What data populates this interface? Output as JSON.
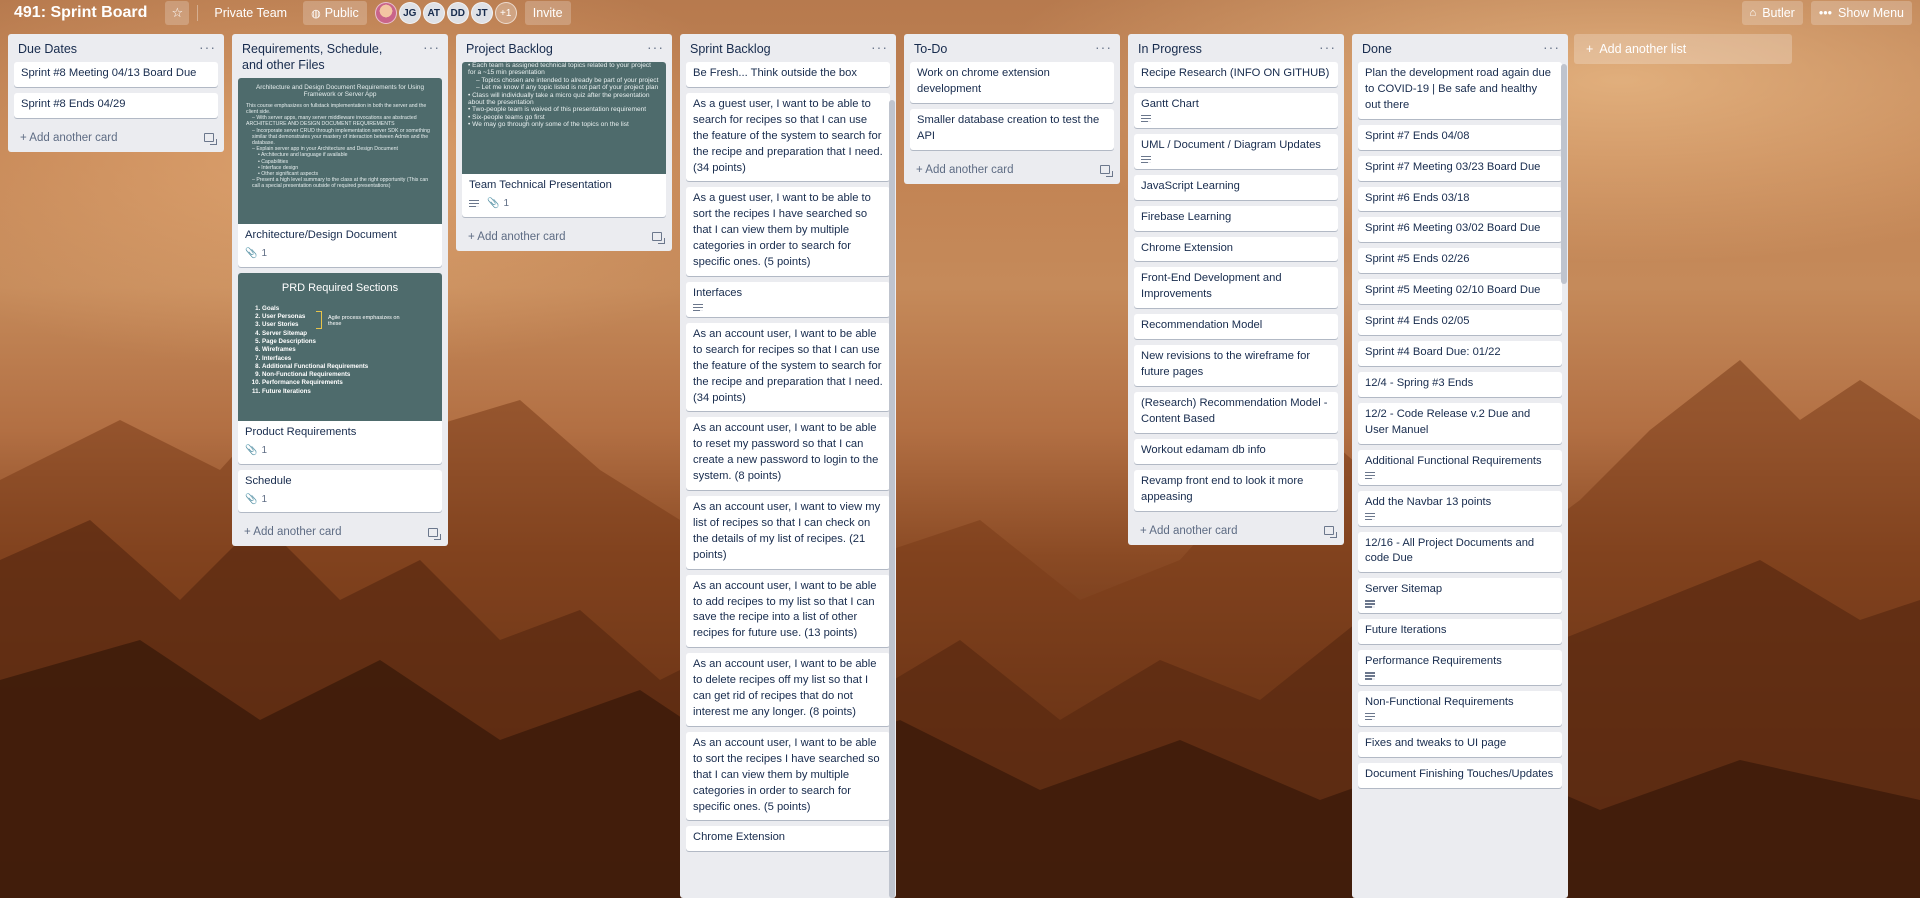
{
  "header": {
    "title": "491: Sprint Board",
    "team": "Private Team",
    "visibility": "Public",
    "members": [
      "JG",
      "AT",
      "DD",
      "JT"
    ],
    "more_members": "+1",
    "invite": "Invite",
    "butler": "Butler",
    "show_menu": "Show Menu"
  },
  "add_card_label": "Add another card",
  "add_list_label": "Add another list",
  "lists": {
    "due_dates": {
      "title": "Due Dates",
      "cards": [
        "Sprint #8 Meeting 04/13 Board Due",
        "Sprint #8 Ends 04/29"
      ]
    },
    "requirements": {
      "title": "Requirements, Schedule, and other Files",
      "cards": [
        {
          "title": "Architecture/Design Document",
          "attachments": "1"
        },
        {
          "title": "Product Requirements",
          "attachments": "1"
        },
        {
          "title": "Schedule",
          "attachments": "1"
        }
      ],
      "cover1": {
        "heading": "Architecture and Design Document Requirements for Using Framework or Server App",
        "lines": [
          "This course emphasizes on fullstack implementation in both the server and the client side.",
          "– With server apps, many server middleware invocations are abstracted",
          "ARCHITECTURE AND DESIGN DOCUMENT REQUIREMENTS",
          "– Incorporate server CRUD through implementation server SDK or something similar that demonstrates your mastery of interaction between Admin and the database.",
          "– Explain server app in your Architecture and Design Document",
          "• Architecture and language if available",
          "• Capabilities",
          "• Interface design",
          "• Other significant aspects",
          "– Present a high level summary to the class at the right opportunity (This can call a special presentation outside of required presentations)"
        ]
      },
      "cover2": {
        "heading": "PRD Required Sections",
        "items": [
          "Goals",
          "User Personas",
          "User Stories",
          "Server Sitemap",
          "Page Descriptions",
          "Wireframes",
          "Interfaces",
          "Additional Functional Requirements",
          "Non-Functional Requirements",
          "Performance Requirements",
          "Future Iterations"
        ],
        "note": "Agile process emphasizes on these"
      }
    },
    "project_backlog": {
      "title": "Project Backlog",
      "card": {
        "title": "Team Technical Presentation",
        "attachments": "1"
      },
      "cover_lines": [
        "• Each team is assigned technical topics related to your project for a ~15 min presentation",
        "– Topics chosen are intended to already be part of your project",
        "– Let me know if any topic listed is not part of your project plan",
        "• Class will individually take a micro quiz after the presentation about the presentation",
        "• Two-people team is waived of this presentation requirement",
        "• Six-people teams go first",
        "• We may go through only some of the topics on the list"
      ]
    },
    "sprint_backlog": {
      "title": "Sprint Backlog",
      "cards": [
        {
          "title": "Be Fresh... Think outside the box",
          "desc": false
        },
        {
          "title": "As a guest user, I want to be able to search for recipes so that I can use the feature of the system to search for the recipe and preparation that I need. (34 points)",
          "desc": false
        },
        {
          "title": "As a guest user, I want to be able to sort the recipes I have searched so that I can view them by multiple categories in order to search for specific ones. (5 points)",
          "desc": false
        },
        {
          "title": "Interfaces",
          "desc": true
        },
        {
          "title": "As an account user, I want to be able to search for recipes so that I can use the feature of the system to search for the recipe and preparation that I need. (34 points)",
          "desc": false
        },
        {
          "title": "As an account user, I want to be able to reset my password so that I can create a new password to login to the system. (8 points)",
          "desc": false
        },
        {
          "title": "As an account user, I want to view my list of recipes so that I can check on the details of my list of recipes. (21 points)",
          "desc": false
        },
        {
          "title": "As an account user, I want to be able to add recipes to my list so that I can save the recipe into a list of other recipes for future use. (13 points)",
          "desc": false
        },
        {
          "title": "As an account user, I want to be able to delete recipes off my list so that I can get rid of recipes that do not interest me any longer. (8 points)",
          "desc": false
        },
        {
          "title": "As an account user, I want to be able to sort the recipes I have searched so that I can view them by multiple categories in order to search for specific ones. (5 points)",
          "desc": false
        },
        {
          "title": "Chrome Extension",
          "desc": false
        }
      ]
    },
    "todo": {
      "title": "To-Do",
      "cards": [
        "Work on chrome extension development",
        "Smaller database creation to test the API"
      ]
    },
    "in_progress": {
      "title": "In Progress",
      "cards": [
        {
          "title": "Recipe Research (INFO ON GITHUB)",
          "desc": false
        },
        {
          "title": "Gantt Chart",
          "desc": true
        },
        {
          "title": "UML / Document / Diagram Updates",
          "desc": true
        },
        {
          "title": "JavaScript Learning",
          "desc": false
        },
        {
          "title": "Firebase Learning",
          "desc": false
        },
        {
          "title": "Chrome Extension",
          "desc": false
        },
        {
          "title": "Front-End Development and Improvements",
          "desc": false
        },
        {
          "title": "Recommendation Model",
          "desc": false
        },
        {
          "title": "New revisions to the wireframe for future pages",
          "desc": false
        },
        {
          "title": "(Research) Recommendation Model - Content Based",
          "desc": false
        },
        {
          "title": "Workout edamam db info",
          "desc": false
        },
        {
          "title": "Revamp front end to look it more appeasing",
          "desc": false
        }
      ]
    },
    "done": {
      "title": "Done",
      "cards": [
        {
          "title": "Plan the development road again due to COVID-19 | Be safe and healthy out there",
          "desc": false
        },
        {
          "title": "Sprint #7 Ends 04/08",
          "desc": false
        },
        {
          "title": "Sprint #7 Meeting 03/23 Board Due",
          "desc": false
        },
        {
          "title": "Sprint #6 Ends 03/18",
          "desc": false
        },
        {
          "title": "Sprint #6 Meeting 03/02 Board Due",
          "desc": false
        },
        {
          "title": "Sprint #5 Ends 02/26",
          "desc": false
        },
        {
          "title": "Sprint #5 Meeting 02/10 Board Due",
          "desc": false
        },
        {
          "title": "Sprint #4 Ends 02/05",
          "desc": false
        },
        {
          "title": "Sprint #4 Board Due: 01/22",
          "desc": false
        },
        {
          "title": "12/4 - Spring #3 Ends",
          "desc": false
        },
        {
          "title": "12/2 - Code Release v.2 Due and User Manuel",
          "desc": false
        },
        {
          "title": "Additional Functional Requirements",
          "desc": true
        },
        {
          "title": "Add the Navbar 13 points",
          "desc": true
        },
        {
          "title": "12/16 - All Project Documents and code Due",
          "desc": false
        },
        {
          "title": "Server Sitemap",
          "desc": true
        },
        {
          "title": "Future Iterations",
          "desc": false
        },
        {
          "title": "Performance Requirements",
          "desc": true
        },
        {
          "title": "Non-Functional Requirements",
          "desc": true
        },
        {
          "title": "Fixes and tweaks to UI page",
          "desc": false
        },
        {
          "title": "Document Finishing Touches/Updates",
          "desc": false
        }
      ]
    }
  }
}
